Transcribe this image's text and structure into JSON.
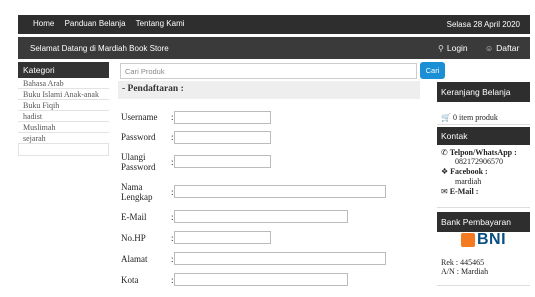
{
  "topnav": {
    "items": [
      "Home",
      "Panduan Belanja",
      "Tentang Kami"
    ],
    "date": "Selasa 28 April 2020"
  },
  "subbar": {
    "welcome": "Selamat Datang di Mardiah Book Store",
    "login": "Login",
    "register": "Daftar"
  },
  "sidebar": {
    "title": "Kategori",
    "items": [
      "Bahasa Arab",
      "Buku Islami Anak-anak",
      "Buku Fiqih",
      "hadist",
      "Muslimah",
      "sejarah"
    ]
  },
  "search": {
    "placeholder": "Cari Produk",
    "button": "Cari"
  },
  "form": {
    "heading": "- Pendaftaran :",
    "fields": [
      {
        "label": "Username"
      },
      {
        "label": "Password"
      },
      {
        "label": "Ulangi Password"
      },
      {
        "label": "Nama Lengkap"
      },
      {
        "label": "E-Mail"
      },
      {
        "label": "No.HP"
      },
      {
        "label": "Alamat"
      },
      {
        "label": "Kota"
      }
    ],
    "colon": ":"
  },
  "cart": {
    "title": "Keranjang Belanja",
    "text": "0 item produk"
  },
  "contact": {
    "title": "Kontak",
    "phone_label": "Telpon/WhatsApp :",
    "phone": "082172906570",
    "facebook_label": "Facebook :",
    "facebook": "mardiah",
    "email_label": "E-Mail :"
  },
  "bank": {
    "title": "Bank Pembayaran",
    "logo_text": "BNI",
    "rek": "Rek : 445465",
    "an": "A/N : Mardiah"
  },
  "icons": {
    "login": "key-icon",
    "register": "user-icon",
    "cart": "cart-icon",
    "phone": "phone-icon",
    "facebook": "comment-icon",
    "email": "envelope-icon"
  },
  "colors": {
    "bar": "#2e2e2e",
    "button": "#1b8fd6",
    "bni": "#0a4f80",
    "bni_mark": "#f47920"
  }
}
